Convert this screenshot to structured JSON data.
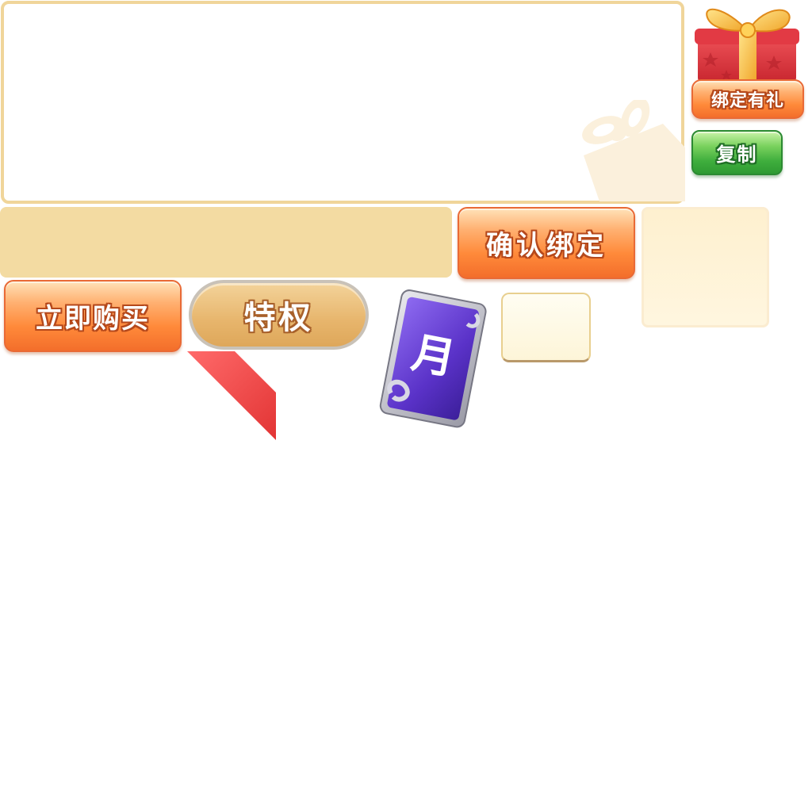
{
  "gift_panel": {
    "bind_gift_label": "绑定有礼",
    "copy_label": "复制"
  },
  "bind_form": {
    "code_value": "",
    "code_placeholder": "",
    "confirm_label": "确认绑定"
  },
  "shop": {
    "buy_now_label": "立即购买",
    "privilege_label": "特权",
    "month_card_glyph": "月"
  },
  "colors": {
    "panel_border": "#f0d59a",
    "input_fill": "#f3dba2",
    "orange_button": "#ff8a3a",
    "green_button": "#3fae3d",
    "ribbon_red": "#ee4040",
    "card_purple": "#6a3fd0"
  },
  "icons": {
    "gift_box": "gift-box-icon",
    "watermark": "gift-watermark-icon",
    "month_card": "month-card-icon",
    "ribbon": "ribbon-corner-icon"
  }
}
